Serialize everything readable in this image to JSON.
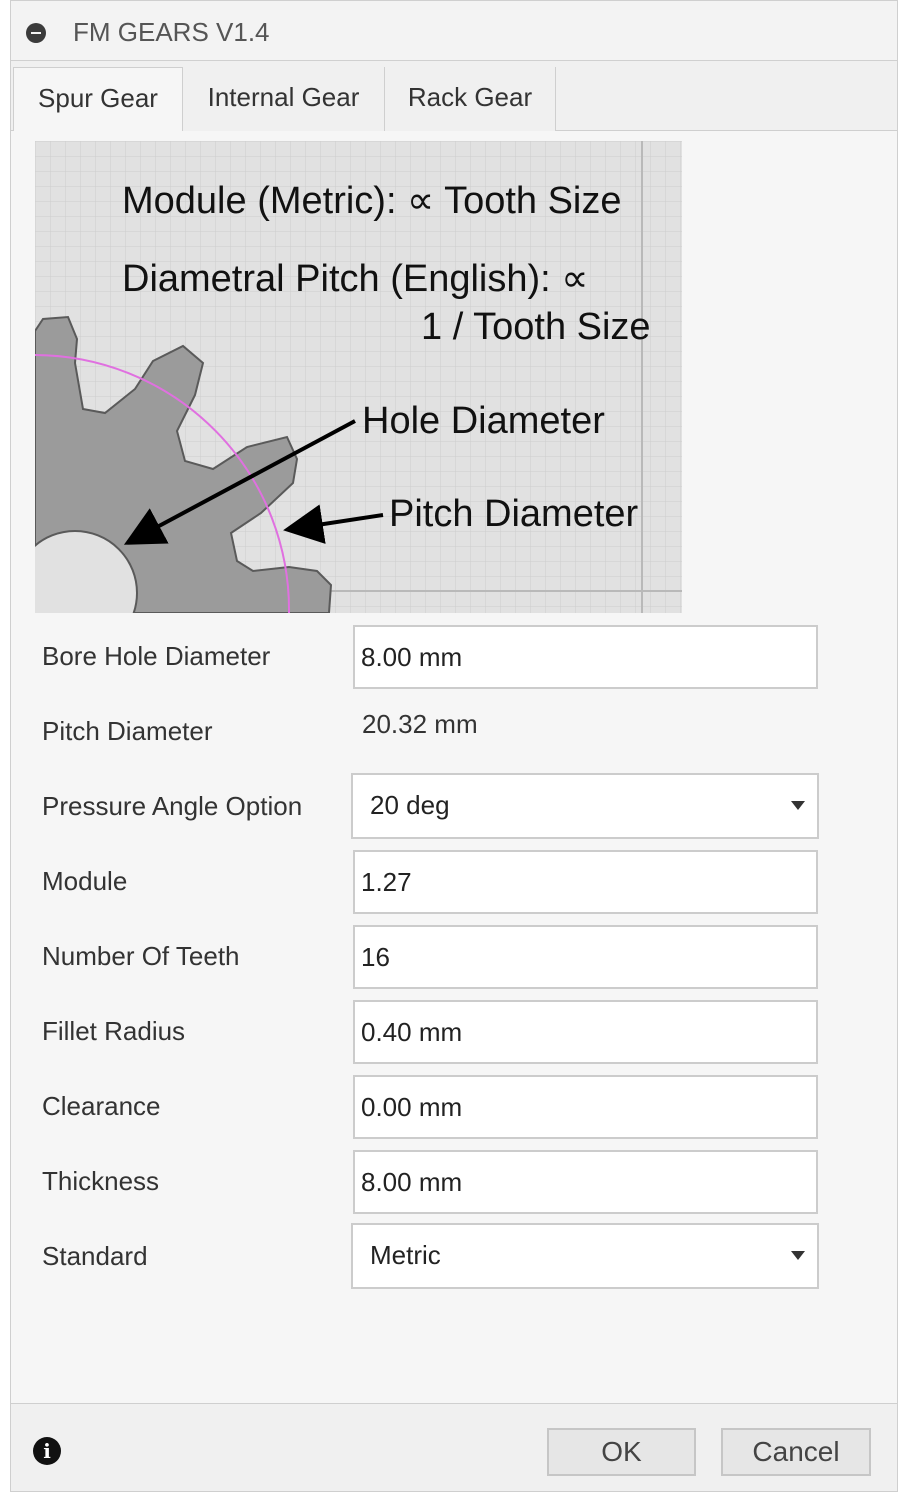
{
  "window": {
    "title": "FM GEARS V1.4"
  },
  "tabs": [
    {
      "label": "Spur Gear",
      "active": true
    },
    {
      "label": "Internal Gear",
      "active": false
    },
    {
      "label": "Rack Gear",
      "active": false
    }
  ],
  "illustration": {
    "line1": "Module (Metric): ∝ Tooth Size",
    "line2": "Diametral Pitch (English): ∝",
    "line3": "1 / Tooth Size",
    "hole_label": "Hole Diameter",
    "pitch_label": "Pitch Diameter"
  },
  "form": {
    "bore_hole_diameter": {
      "label": "Bore Hole Diameter",
      "value": "8.00 mm"
    },
    "pitch_diameter": {
      "label": "Pitch Diameter",
      "value": "20.32 mm"
    },
    "pressure_angle": {
      "label": "Pressure Angle Option",
      "value": "20 deg"
    },
    "module": {
      "label": "Module",
      "value": "1.27"
    },
    "number_of_teeth": {
      "label": "Number Of Teeth",
      "value": "16"
    },
    "fillet_radius": {
      "label": "Fillet Radius",
      "value": "0.40 mm"
    },
    "clearance": {
      "label": "Clearance",
      "value": "0.00 mm"
    },
    "thickness": {
      "label": "Thickness",
      "value": "8.00 mm"
    },
    "standard": {
      "label": "Standard",
      "value": "Metric"
    }
  },
  "footer": {
    "ok_label": "OK",
    "cancel_label": "Cancel",
    "info_icon": "info-icon"
  }
}
